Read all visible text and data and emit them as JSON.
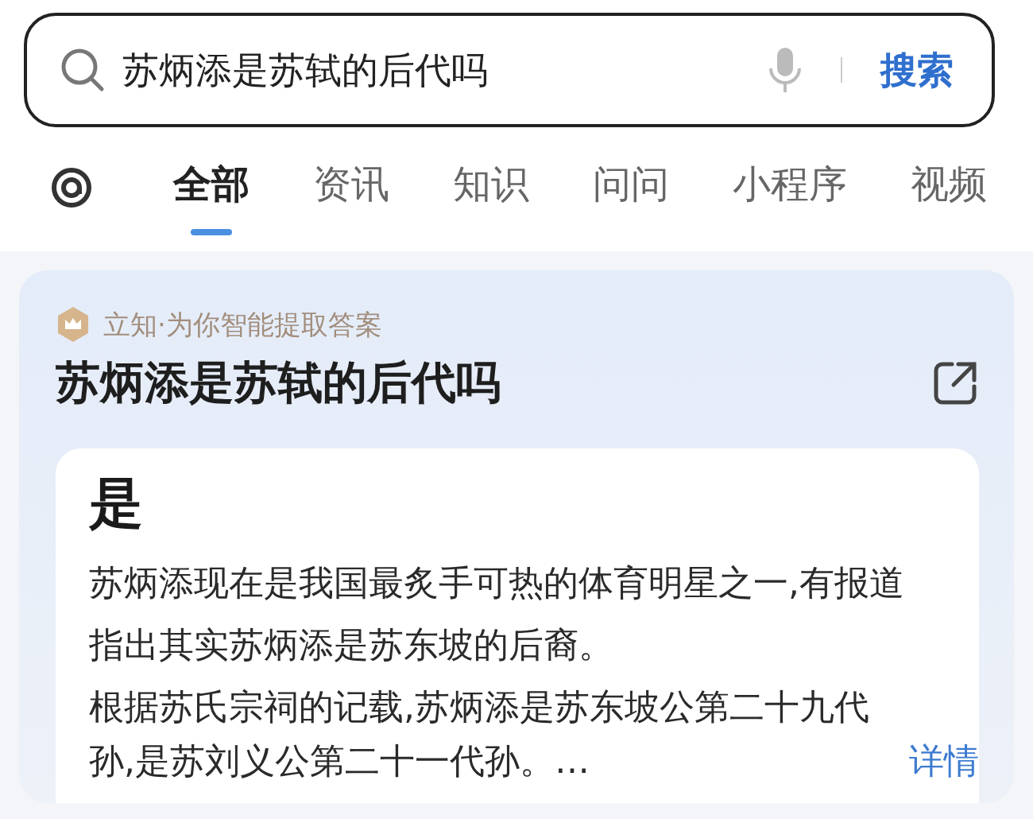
{
  "search": {
    "query": "苏炳添是苏轼的后代吗",
    "button": "搜索"
  },
  "tabs": [
    {
      "label": "全部",
      "selected": true
    },
    {
      "label": "资讯",
      "selected": false
    },
    {
      "label": "知识",
      "selected": false
    },
    {
      "label": "问问",
      "selected": false
    },
    {
      "label": "小程序",
      "selected": false
    },
    {
      "label": "视频",
      "selected": false
    }
  ],
  "answer": {
    "source": "立知·为你智能提取答案",
    "title": "苏炳添是苏轼的后代吗",
    "verdict": "是",
    "paragraphs": [
      "苏炳添现在是我国最炙手可热的体育明星之一,有报道指出其实苏炳添是苏东坡的后裔。",
      "根据苏氏宗祠的记载,苏炳添是苏东坡公第二十九代"
    ],
    "last_line": "孙,是苏刘义公第二十一代孙。…",
    "more_link": "详情"
  }
}
